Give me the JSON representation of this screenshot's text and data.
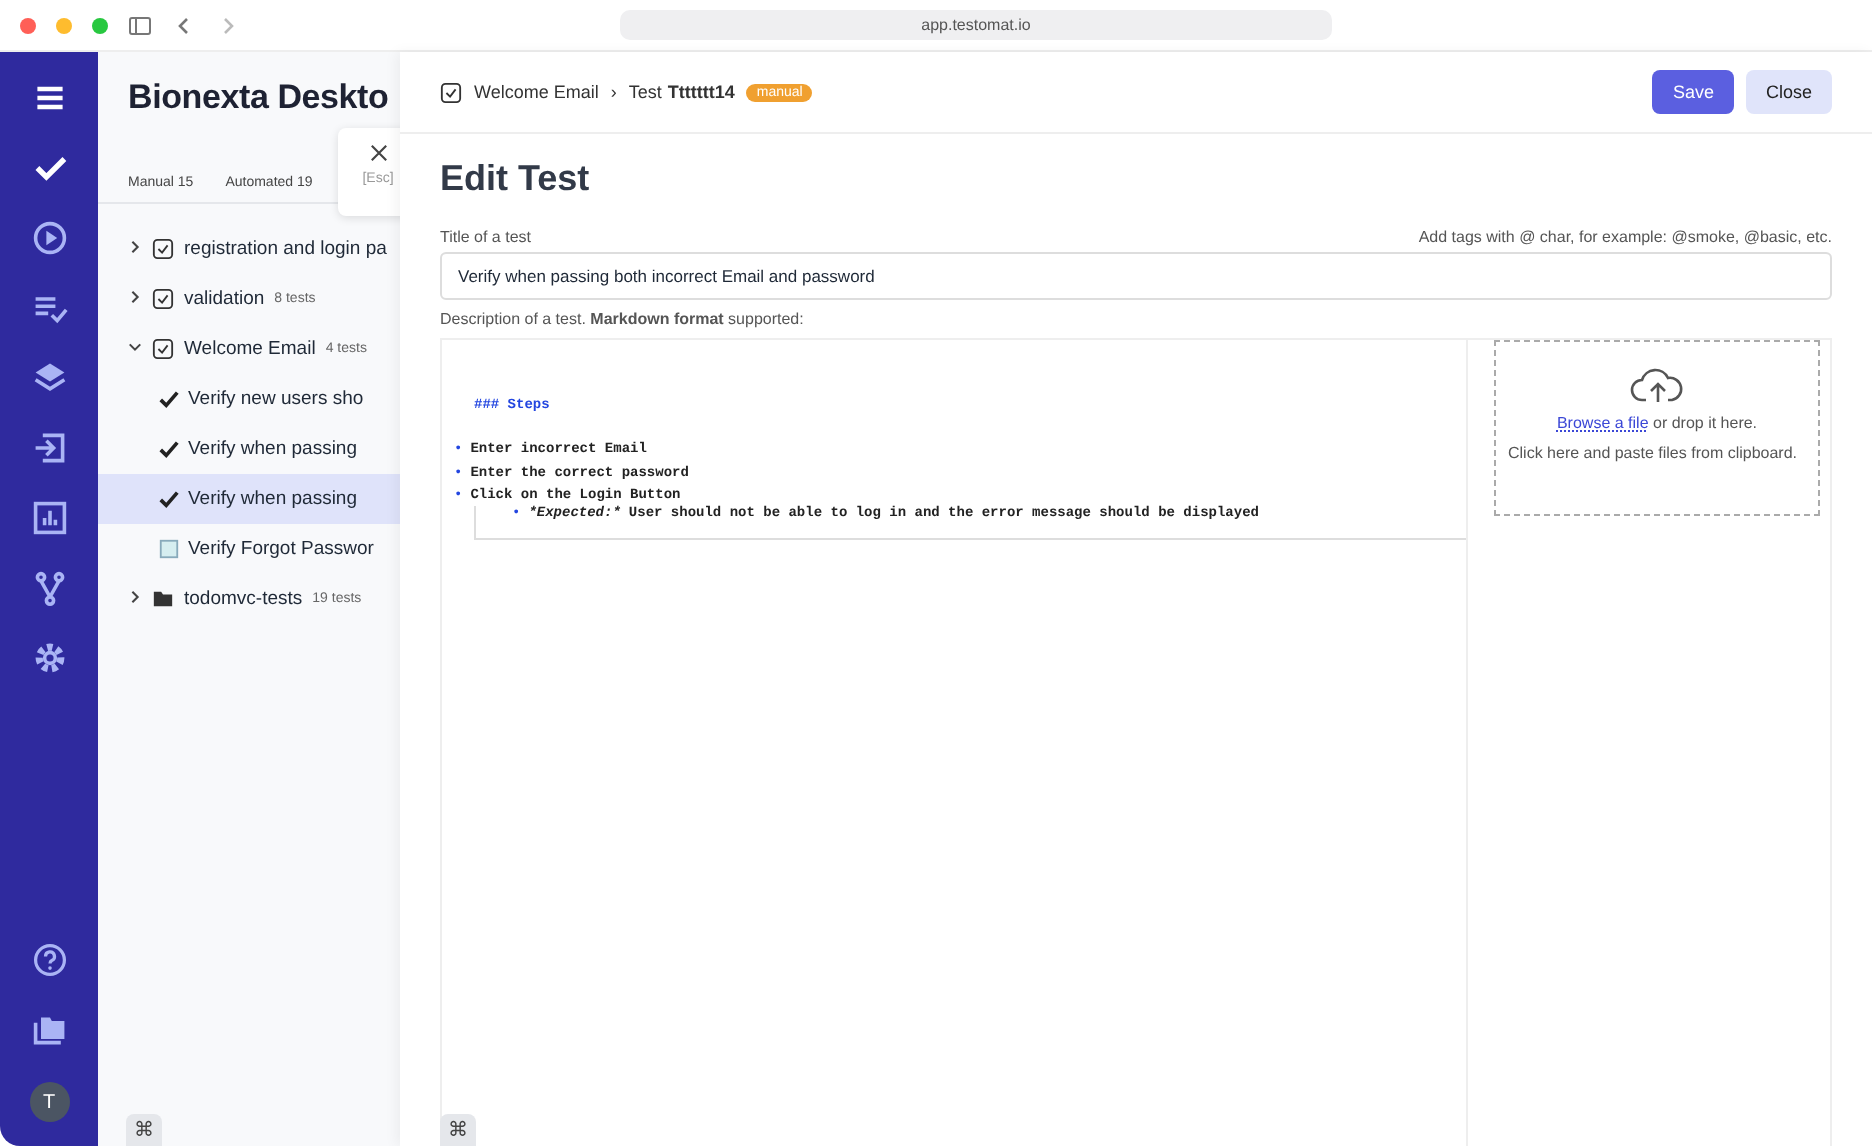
{
  "browser": {
    "url": "app.testomat.io"
  },
  "sidebar": {
    "items": [
      {
        "selected": true
      },
      {
        "selected": false
      },
      {
        "selected": false
      },
      {
        "selected": false
      },
      {
        "selected": false
      },
      {
        "selected": false
      },
      {
        "selected": false
      },
      {
        "selected": false
      }
    ],
    "avatar": "T"
  },
  "project": {
    "title": "Bionexta Deskto",
    "close_hint": "[Esc]",
    "filters": [
      "Manual 15",
      "Automated 19"
    ],
    "tree": [
      {
        "kind": "suite",
        "label": "registration and login pa",
        "expanded": false
      },
      {
        "kind": "suite",
        "label": "validation",
        "count": "8 tests",
        "expanded": false
      },
      {
        "kind": "suite",
        "label": "Welcome Email",
        "count": "4 tests",
        "expanded": true,
        "children": [
          {
            "kind": "automated",
            "label": "Verify new users sho",
            "selected": false
          },
          {
            "kind": "automated",
            "label": "Verify when passing",
            "selected": false
          },
          {
            "kind": "automated",
            "label": "Verify when passing",
            "selected": true
          },
          {
            "kind": "manual",
            "label": "Verify Forgot Passwor",
            "selected": false
          }
        ]
      },
      {
        "kind": "folder",
        "label": "todomvc-tests",
        "count": "19 tests",
        "expanded": false
      }
    ]
  },
  "editor": {
    "breadcrumb": {
      "suite": "Welcome Email",
      "separator": "›",
      "prefix": "Test",
      "name": "Ttttttt14",
      "badge": "manual"
    },
    "buttons": [
      {
        "label": "Save",
        "kind": "primary"
      },
      {
        "label": "Close",
        "kind": "secondary"
      }
    ],
    "heading": "Edit Test",
    "title_label": "Title of a test",
    "tags_hint": "Add tags with @ char, for example: @smoke, @basic, etc.",
    "title_value": "Verify when passing both incorrect Email and password",
    "description_label": "Description of a test. **Markdown format** supported:",
    "lines": [
      {
        "kind": "heading",
        "text": "### Steps"
      },
      {
        "kind": "blank"
      },
      {
        "kind": "bullet",
        "marker": "•",
        "text": "Enter incorrect Email"
      },
      {
        "kind": "bullet",
        "marker": "•",
        "text": "Enter the correct password"
      },
      {
        "kind": "bullet",
        "marker": "•",
        "text": "Click on the Login Button"
      },
      {
        "kind": "sub",
        "marker": "•",
        "emphasis": "*Expected:*",
        "text": "User should not be able to log in and the error message should be displayed"
      }
    ],
    "dropzone": {
      "link": "Browse a file",
      "text": "or drop it here.",
      "text2": "Click here and paste files from clipboard."
    }
  },
  "shortcut_keys": [
    "⌘",
    "⌘"
  ]
}
